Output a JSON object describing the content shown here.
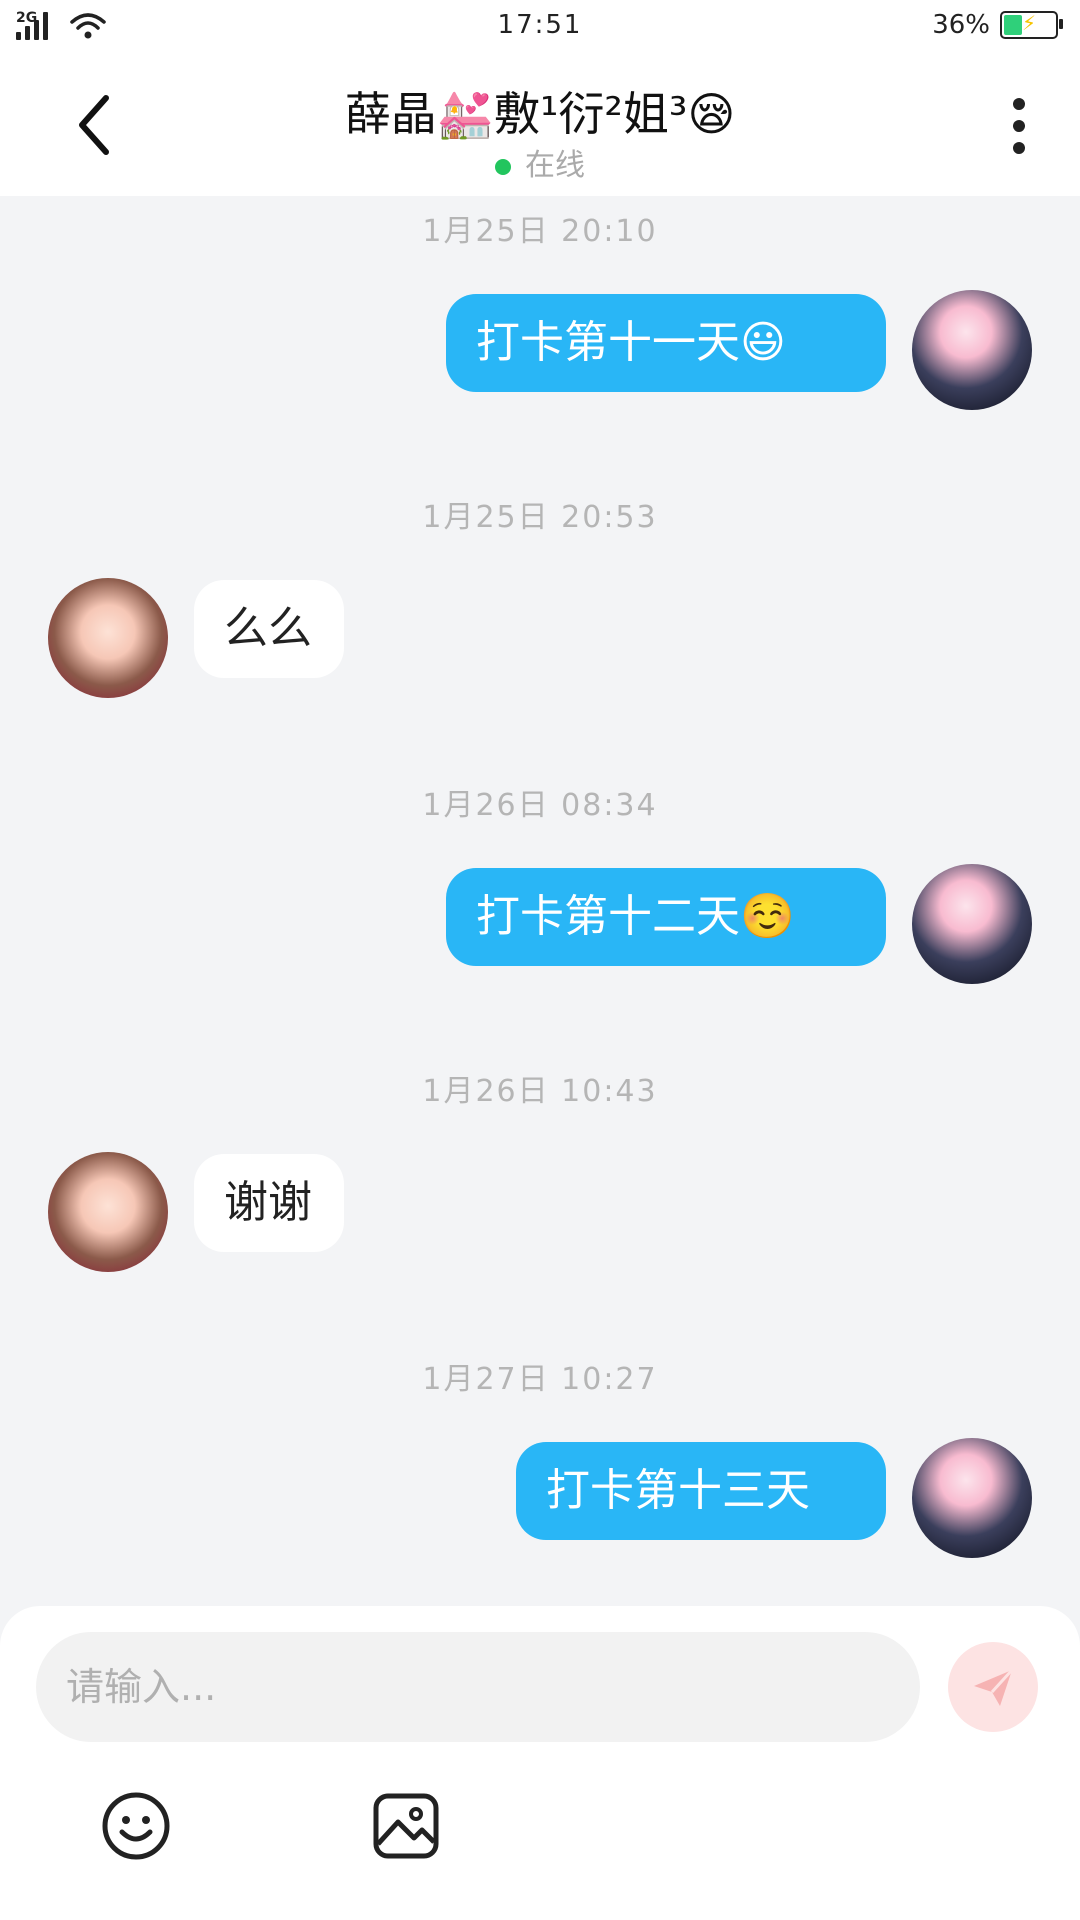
{
  "status_bar": {
    "signal_label": "2G",
    "time": "17:51",
    "battery_percent": "36%",
    "battery_level": 0.36
  },
  "header": {
    "title": "薛晶💒敷¹衍²姐³😪",
    "status": "在线",
    "status_color": "#22c55e"
  },
  "messages": [
    {
      "timestamp": "1月25日 20:10",
      "sender": "me",
      "text": "打卡第十一天😃"
    },
    {
      "timestamp": "1月25日 20:53",
      "sender": "peer",
      "text": "么么"
    },
    {
      "timestamp": "1月26日 08:34",
      "sender": "me",
      "text": "打卡第十二天☺️"
    },
    {
      "timestamp": "1月26日 10:43",
      "sender": "peer",
      "text": "谢谢"
    },
    {
      "timestamp": "1月27日 10:27",
      "sender": "me",
      "text": "打卡第十三天"
    }
  ],
  "composer": {
    "placeholder": "请输入...",
    "value": ""
  },
  "icons": {
    "back": "back-arrow-icon",
    "more": "more-vertical-icon",
    "send": "send-icon",
    "emoji": "emoji-icon",
    "image": "image-icon"
  },
  "colors": {
    "outgoing_bubble": "#29b6f6",
    "incoming_bubble": "#ffffff",
    "send_button": "#fde3e3",
    "background": "#f3f4f6"
  }
}
